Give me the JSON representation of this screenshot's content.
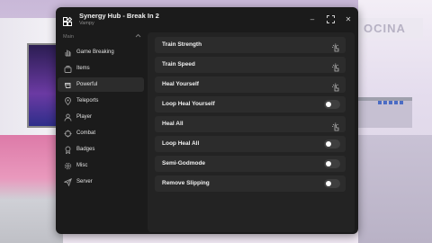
{
  "background": {
    "sign_text": "OCINA"
  },
  "window": {
    "title": "Synergy Hub - Break In 2",
    "subtitle": "Vampy",
    "controls": {
      "minimize": "–",
      "maximize": "⛶",
      "close": "✕"
    }
  },
  "sidebar": {
    "section_label": "Main",
    "items": [
      {
        "label": "Game Breaking",
        "icon": "hand-icon"
      },
      {
        "label": "Items",
        "icon": "bag-icon"
      },
      {
        "label": "Powerful",
        "icon": "fist-icon",
        "active": true
      },
      {
        "label": "Teleports",
        "icon": "location-pin-icon"
      },
      {
        "label": "Player",
        "icon": "user-icon"
      },
      {
        "label": "Combat",
        "icon": "crosshair-icon"
      },
      {
        "label": "Badges",
        "icon": "badge-icon"
      },
      {
        "label": "Misc",
        "icon": "gear-icon"
      },
      {
        "label": "Server",
        "icon": "send-icon"
      }
    ]
  },
  "content": {
    "rows": [
      {
        "label": "Train Strength",
        "type": "button"
      },
      {
        "label": "Train Speed",
        "type": "button"
      },
      {
        "label": "Heal Yourself",
        "type": "button"
      },
      {
        "label": "Loop Heal Yourself",
        "type": "toggle",
        "on": false
      },
      {
        "label": "Heal All",
        "type": "button"
      },
      {
        "label": "Loop Heal All",
        "type": "toggle",
        "on": false
      },
      {
        "label": "Semi-Godmode",
        "type": "toggle",
        "on": false
      },
      {
        "label": "Remove Slipping",
        "type": "toggle",
        "on": false
      }
    ]
  },
  "colors": {
    "window_bg": "#1b1b1b",
    "panel_bg": "#232323",
    "row_bg": "#2c2c2c",
    "active_item_bg": "#2c2c2c",
    "toggle_off": "#3f3f3f"
  }
}
